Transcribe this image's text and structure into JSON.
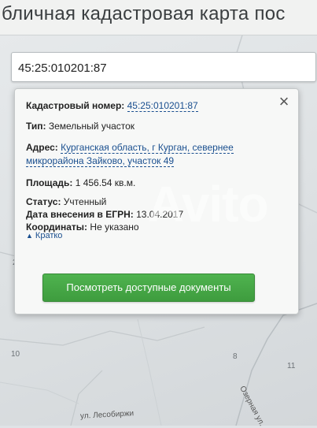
{
  "header": {
    "title": "бличная кадастровая карта пос"
  },
  "search": {
    "value": "45:25:010201:87"
  },
  "popup": {
    "close_icon": "close-icon",
    "cadastral_label": "Кадастровый номер:",
    "cadastral_value": "45:25:010201:87",
    "type_label": "Тип:",
    "type_value": "Земельный участок",
    "address_label": "Адрес:",
    "address_value": "Курганская область, г Курган, севернее микрорайона Зайково, участок 49",
    "area_label": "Площадь:",
    "area_value": "1 456.54 кв.м.",
    "status_label": "Статус:",
    "status_value": "Учтенный",
    "date_label": "Дата внесения в ЕГРН:",
    "date_value": "13.04.2017",
    "coords_label": "Координаты:",
    "coords_value": "Не указано",
    "brief_link": "Кратко",
    "docs_button": "Посмотреть доступные документы"
  },
  "map": {
    "labels": [
      "2",
      "10",
      "8",
      "11"
    ],
    "street_1": "ул. Лесобиржи",
    "street_2": "Озерная ул."
  },
  "watermark": "Avito",
  "colors": {
    "button_green": "#45a845",
    "link_blue": "#1a4f8f"
  }
}
